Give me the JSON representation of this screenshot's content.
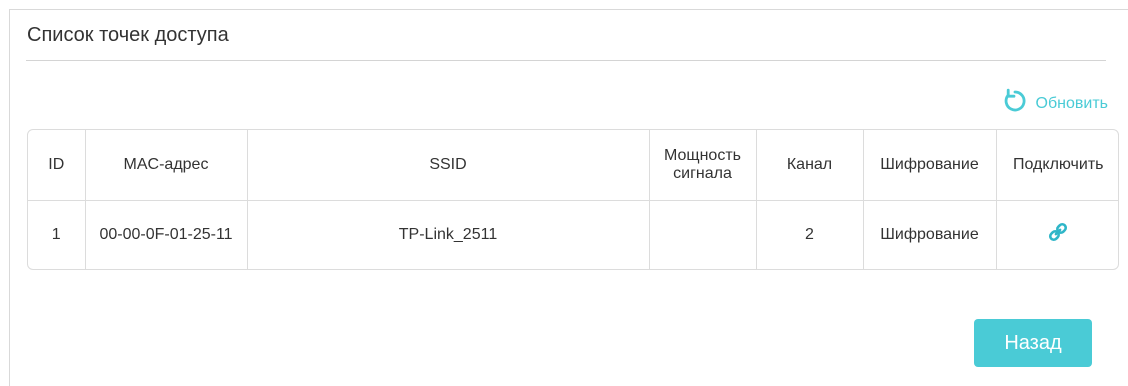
{
  "panel": {
    "title": "Список точек доступа"
  },
  "refresh": {
    "label": "Обновить",
    "icon": "refresh-icon"
  },
  "table": {
    "columns": [
      {
        "key": "id",
        "label": "ID"
      },
      {
        "key": "mac",
        "label": "MAC-адрес"
      },
      {
        "key": "ssid",
        "label": "SSID"
      },
      {
        "key": "signal",
        "label": "Мощность сигнала"
      },
      {
        "key": "channel",
        "label": "Канал"
      },
      {
        "key": "encryption",
        "label": "Шифрование"
      },
      {
        "key": "connect",
        "label": "Подключить"
      }
    ],
    "rows": [
      {
        "id": "1",
        "mac": "00-00-0F-01-25-11",
        "ssid": "TP-Link_2511",
        "signal": "",
        "channel": "2",
        "encryption": "Шифрование",
        "connect_icon": "link-icon"
      }
    ]
  },
  "back_button": {
    "label": "Назад"
  },
  "colors": {
    "accent": "#4acbd6",
    "border": "#dcdcdc",
    "text": "#333333"
  }
}
